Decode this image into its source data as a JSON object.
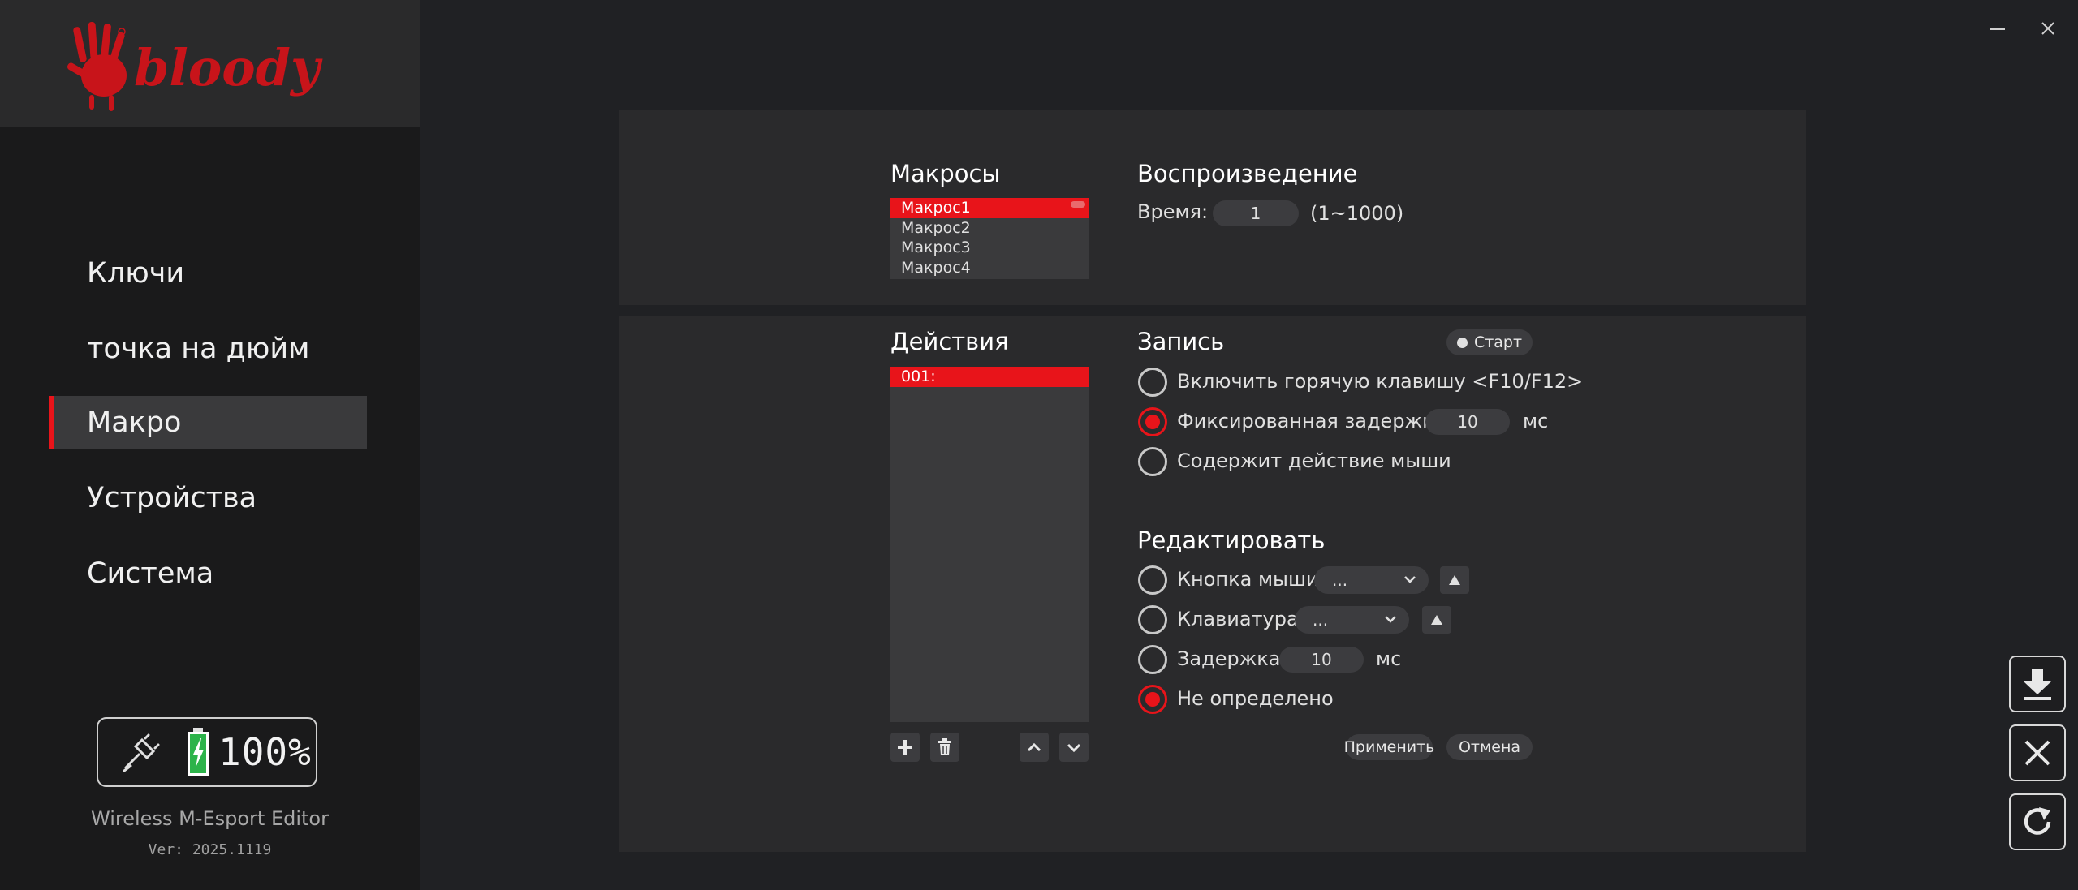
{
  "brand": {
    "logo_text": "bloody"
  },
  "window": {
    "minimize_icon": "minimize-icon",
    "close_icon": "close-icon"
  },
  "sidebar": {
    "items": [
      {
        "label": "Ключи"
      },
      {
        "label": "точка на дюйм"
      },
      {
        "label": "Макро",
        "active": true
      },
      {
        "label": "Устройства"
      },
      {
        "label": "Система"
      }
    ],
    "battery": {
      "percent": "100%",
      "connection_icon": "usb-plug-icon",
      "battery_icon": "battery-charging-icon"
    },
    "app_name": "Wireless M-Esport Editor",
    "version": "Ver: 2025.1119"
  },
  "macros": {
    "title": "Макросы",
    "items": [
      "Макрос1",
      "Макрос2",
      "Макрос3",
      "Макрос4"
    ],
    "selected_index": 0
  },
  "playback": {
    "title": "Воспроизведение",
    "time_label": "Время:",
    "time_value": "1",
    "time_range": "(1~1000)"
  },
  "actions": {
    "title": "Действия",
    "items": [
      "001:"
    ],
    "selected_index": 0,
    "toolbar_icons": [
      "plus-icon",
      "trash-icon",
      "chevron-up-icon",
      "chevron-down-icon"
    ]
  },
  "record": {
    "title": "Запись",
    "start_label": "Старт",
    "options": [
      {
        "label": "Включить горячую клавишу <F10/F12>",
        "checked": false
      },
      {
        "label": "Фиксированная задержка",
        "checked": true,
        "value": "10",
        "unit": "мс"
      },
      {
        "label": "Содержит действие мыши",
        "checked": false
      }
    ]
  },
  "edit": {
    "title": "Редактировать",
    "options": [
      {
        "label": "Кнопка мыши",
        "checked": false,
        "dropdown": "..."
      },
      {
        "label": "Клавиатура",
        "checked": false,
        "dropdown": "..."
      },
      {
        "label": "Задержка",
        "checked": false,
        "value": "10",
        "unit": "мс"
      },
      {
        "label": "Не определено",
        "checked": true
      }
    ],
    "apply_label": "Применить",
    "cancel_label": "Отмена"
  },
  "side_buttons": [
    "download-icon",
    "close-icon",
    "refresh-icon"
  ],
  "colors": {
    "accent": "#e8141a",
    "background": "#202124",
    "panel": "#2a2a2c",
    "sidebar": "#1a1a1b"
  }
}
